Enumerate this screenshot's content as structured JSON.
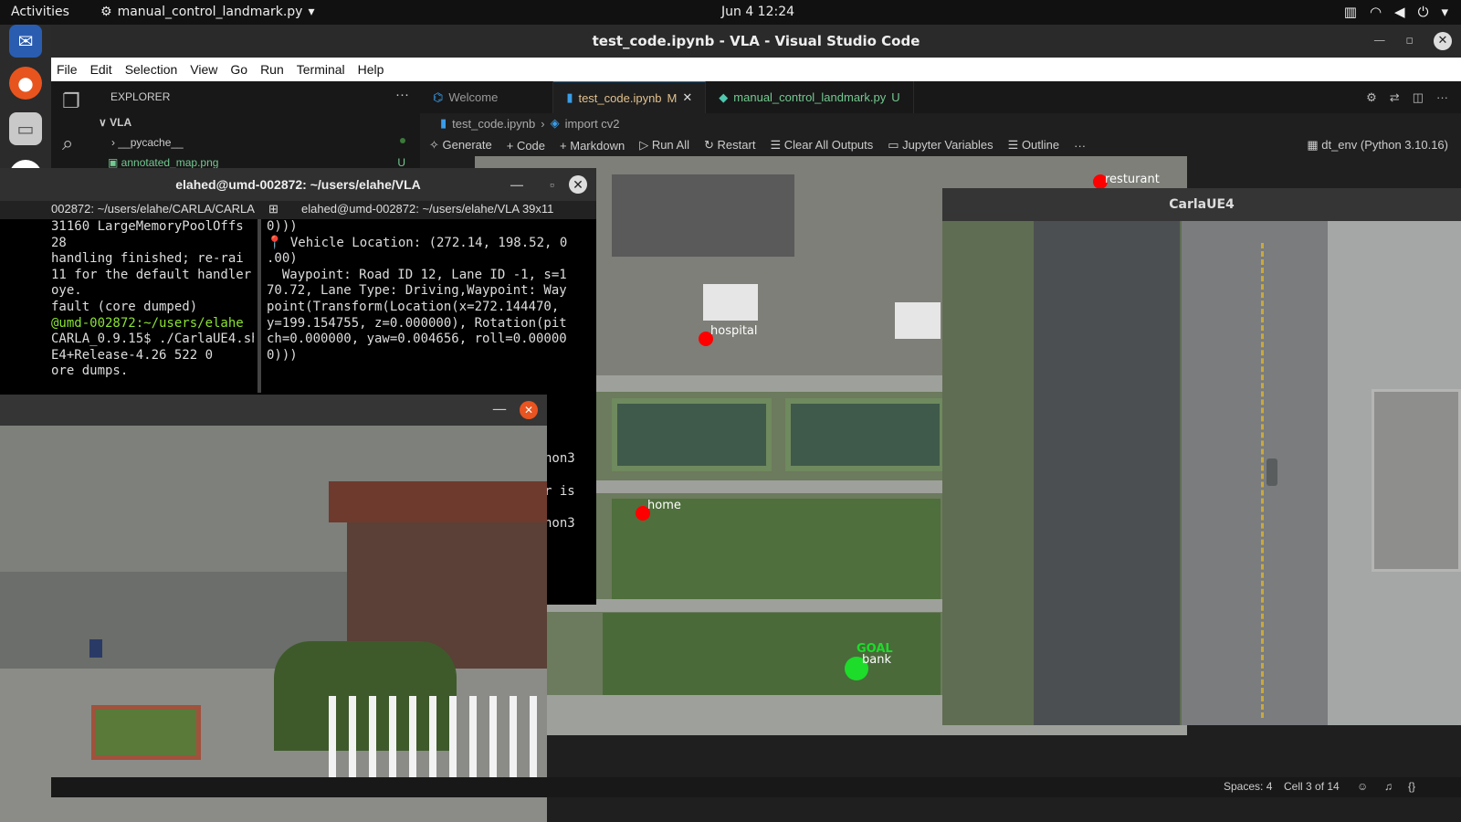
{
  "topbar": {
    "activities": "Activities",
    "app_name": "manual_control_landmark.py",
    "clock": "Jun 4  12:24"
  },
  "vscode": {
    "title": "test_code.ipynb - VLA - Visual Studio Code",
    "menu": [
      "File",
      "Edit",
      "Selection",
      "View",
      "Go",
      "Run",
      "Terminal",
      "Help"
    ],
    "explorer": {
      "header": "EXPLORER",
      "folder": "VLA",
      "items": [
        {
          "name": "__pycache__"
        },
        {
          "name": "annotated_map.png",
          "badge": "U"
        }
      ]
    },
    "tabs": [
      {
        "label": "Welcome",
        "badge": ""
      },
      {
        "label": "test_code.ipynb",
        "badge": "M"
      },
      {
        "label": "manual_control_landmark.py",
        "badge": "U"
      }
    ],
    "breadcrumbs": [
      "test_code.ipynb",
      "import cv2"
    ],
    "notebook_toolbar": [
      "Generate",
      "Code",
      "Markdown",
      "Run All",
      "Restart",
      "Clear All Outputs",
      "Jupyter Variables",
      "Outline"
    ],
    "kernel": "dt_env (Python 3.10.16)",
    "status": {
      "spaces": "Spaces: 4",
      "cell": "Cell 3 of 14"
    }
  },
  "map": {
    "labels": [
      "resturant",
      "hospital",
      "home",
      "bank",
      "GOAL"
    ]
  },
  "carla": {
    "title": "CarlaUE4"
  },
  "terminal": {
    "title": "elahed@umd-002872: ~/users/elahe/VLA",
    "tab_left": "002872: ~/users/elahe/CARLA/CARLA",
    "tab_right": "elahed@umd-002872: ~/users/elahe/VLA 39x11",
    "left_lines": [
      "31160 LargeMemoryPoolOffs",
      "28",
      "handling finished; re-rai",
      "11 for the default handler",
      "oye.",
      "fault (core dumped)",
      "@umd-002872:~/users/elahe",
      "CARLA_0.9.15$ ./CarlaUE4.sh",
      "E4+Release-4.26 522 0",
      "ore dumps."
    ],
    "right_lines": [
      "0)))",
      "",
      "📍 Vehicle Location: (272.14, 198.52, 0",
      ".00)",
      "  Waypoint: Road ID 12, Lane ID -1, s=1",
      "70.72, Lane Type: Driving,Waypoint: Way",
      "point(Transform(Location(x=272.144470,",
      "y=199.154755, z=0.000000), Rotation(pit",
      "ch=0.000000, yaw=0.004656, roll=0.00000",
      "0)))"
    ],
    "partial_lines": [
      "hon3",
      "r is",
      "hon3"
    ]
  }
}
